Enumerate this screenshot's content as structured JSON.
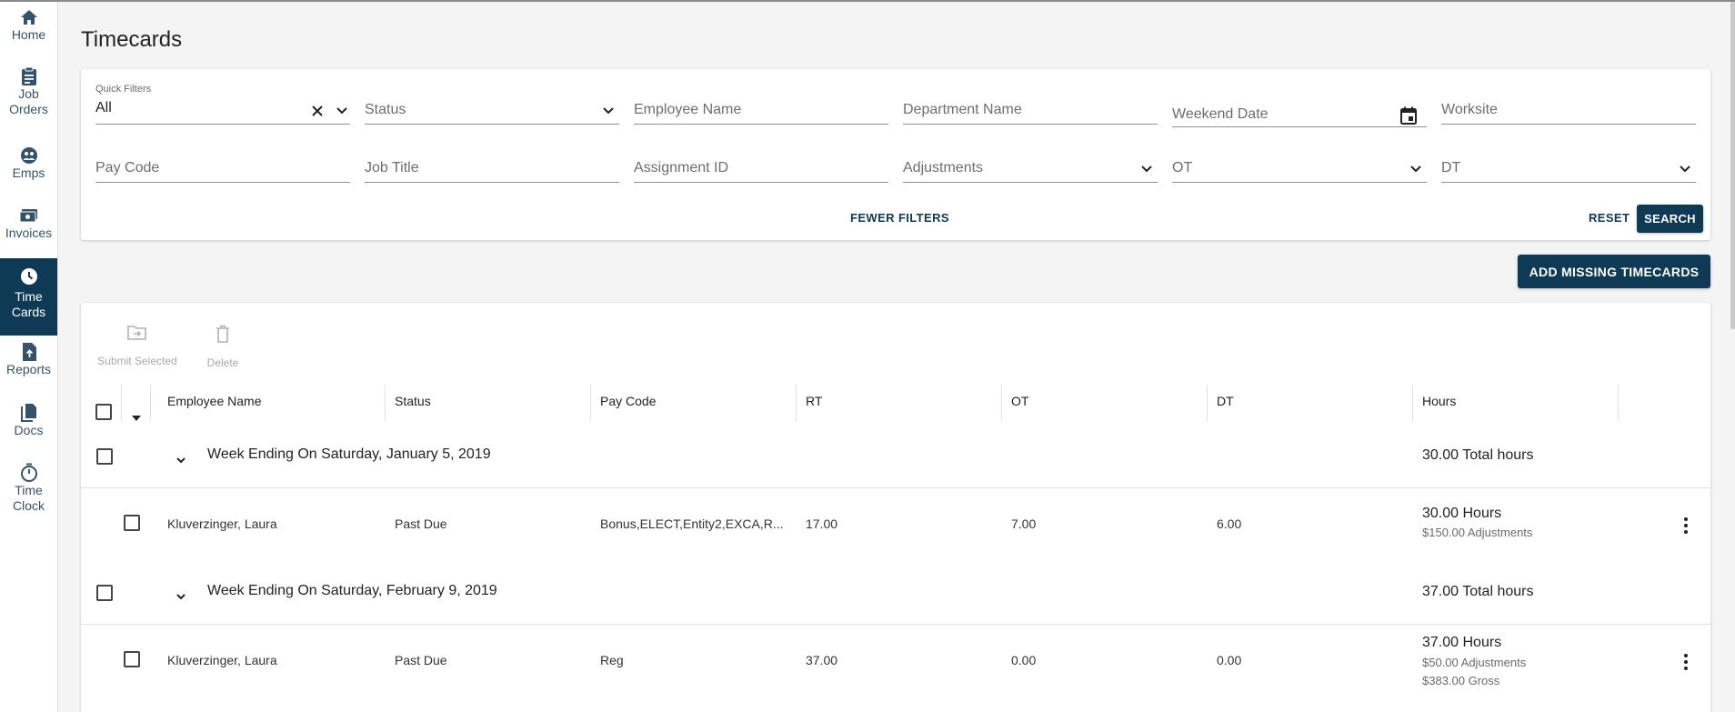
{
  "colors": {
    "primary": "#0e3a55",
    "background": "#f4f4f4",
    "card": "#ffffff"
  },
  "nav": [
    {
      "label_1": "Home",
      "label_2": "",
      "icon": "home-icon"
    },
    {
      "label_1": "Job",
      "label_2": "Orders",
      "icon": "clipboard-icon"
    },
    {
      "label_1": "Emps",
      "label_2": "",
      "icon": "people-icon"
    },
    {
      "label_1": "Invoices",
      "label_2": "",
      "icon": "money-icon"
    },
    {
      "label_1": "Time",
      "label_2": "Cards",
      "icon": "clock-icon",
      "active": true
    },
    {
      "label_1": "Reports",
      "label_2": "",
      "icon": "upload-file-icon"
    },
    {
      "label_1": "Docs",
      "label_2": "",
      "icon": "documents-icon"
    },
    {
      "label_1": "Time",
      "label_2": "Clock",
      "icon": "stopwatch-icon"
    }
  ],
  "page_title": "Timecards",
  "filters": {
    "quick_filters_label": "Quick Filters",
    "quick_filters_value": "All",
    "status": "Status",
    "employee_name": "Employee Name",
    "department_name": "Department Name",
    "weekend_date": "Weekend Date",
    "worksite": "Worksite",
    "pay_code": "Pay Code",
    "job_title": "Job Title",
    "assignment_id": "Assignment ID",
    "adjustments": "Adjustments",
    "ot": "OT",
    "dt": "DT",
    "fewer_filters": "FEWER FILTERS",
    "reset": "RESET",
    "search": "SEARCH"
  },
  "add_missing_timecards": "ADD MISSING TIMECARDS",
  "toolbar": {
    "submit_selected": "Submit Selected",
    "delete": "Delete"
  },
  "columns": [
    "Employee Name",
    "Status",
    "Pay Code",
    "RT",
    "OT",
    "DT",
    "Hours"
  ],
  "groups": [
    {
      "title": "Week Ending On Saturday, January 5, 2019",
      "total": "30.00 Total hours",
      "rows": [
        {
          "employee": "Kluverzinger, Laura",
          "status": "Past Due",
          "pay_code": "Bonus,ELECT,Entity2,EXCA,R...",
          "rt": "17.00",
          "ot": "7.00",
          "dt": "6.00",
          "hours": "30.00 Hours",
          "sub1": "$150.00 Adjustments",
          "sub2": ""
        }
      ]
    },
    {
      "title": "Week Ending On Saturday, February 9, 2019",
      "total": "37.00 Total hours",
      "rows": [
        {
          "employee": "Kluverzinger, Laura",
          "status": "Past Due",
          "pay_code": "Reg",
          "rt": "37.00",
          "ot": "0.00",
          "dt": "0.00",
          "hours": "37.00 Hours",
          "sub1": "$50.00 Adjustments",
          "sub2": "$383.00 Gross"
        }
      ]
    }
  ]
}
